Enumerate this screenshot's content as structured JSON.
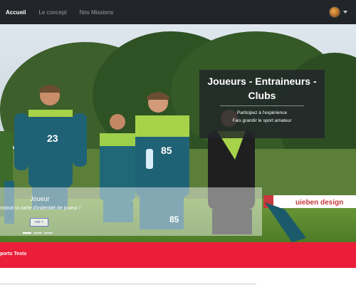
{
  "nav": {
    "items": [
      {
        "label": "Accueil",
        "active": true
      },
      {
        "label": "Le concept",
        "active": false
      },
      {
        "label": "Nos Missions",
        "active": false
      }
    ],
    "user_menu": {
      "avatar_icon": "user-avatar",
      "caret_icon": "caret-down-icon"
    }
  },
  "hero": {
    "overlay": {
      "title": "Joueurs - Entraineurs - Clubs",
      "line1": "Participez à l'expérience",
      "line2": "Fais grandir le sport amateur"
    },
    "photo": {
      "jersey_numbers": [
        "23",
        "85",
        "85"
      ],
      "banner_text": "uieben design"
    },
    "carousel": {
      "title": "Joueur",
      "text": "nstruit ta carte d'indentité de joueur !",
      "button_label": "voir +"
    }
  },
  "footer_band": {
    "text": "ports Tests",
    "color": "#ea1e38"
  }
}
